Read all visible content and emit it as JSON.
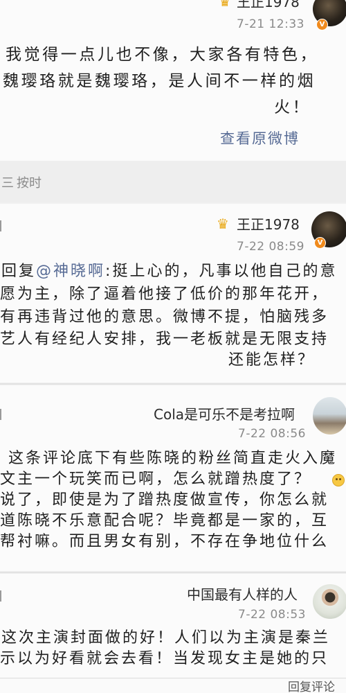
{
  "comments": [
    {
      "name": "王正1978",
      "time": "7-21 12:33",
      "lines": [
        "我觉得一点儿也不像，大家各有特色，",
        "魏璎珞就是魏璎珞，是人间不一样的烟",
        "火！"
      ],
      "view_original": "查看原微博",
      "badge": "V",
      "avatar_icon": "user-avatar"
    },
    {
      "name": "王正1978",
      "time": "7-22 08:59",
      "reply_prefix": "回复",
      "mention": "@神晓啊",
      "first_line_rest": ":挺上心的，凡事以他自己的意",
      "lines": [
        "愿为主，除了逼着他接了低价的那年花开，",
        "有再违背过他的意思。微博不提，怕脑残多",
        "艺人有经纪人安排，我一老板就是无限支持",
        "还能怎样？"
      ],
      "badge": "V",
      "avatar_icon": "user-avatar"
    },
    {
      "name": "Cola是可乐不是考拉啊",
      "time": "7-22 08:56",
      "lines": [
        "这条评论底下有些陈晓的粉丝简直走火入魔",
        "文主一个玩笑而已啊，怎么就蹭热度了？",
        "说了，即使是为了蹭热度做宣传，你怎么就",
        "道陈晓不乐意配合呢？毕竟都是一家的，互",
        "帮衬嘛。而且男女有别，不存在争地位什么"
      ],
      "emoji_icon": "laughing-emoji-icon",
      "avatar_icon": "user-avatar"
    },
    {
      "name": "中国最有人样的人",
      "time": "7-22 08:53",
      "lines": [
        "这次主演封面做的好！人们以为主演是秦兰",
        "示以为好看就会去看！当发现女主是她的只"
      ],
      "avatar_icon": "user-avatar"
    }
  ],
  "sort_bar": {
    "icon": "sort-icon",
    "icon_glyph": "三",
    "label": "按时"
  },
  "footer": {
    "reply_label": "回复评论"
  },
  "colors": {
    "link": "#576b95",
    "time": "#8a8a8a",
    "text": "#1f1f1f",
    "crown": "#e9a816",
    "verified_badge": "#f08a1c"
  }
}
